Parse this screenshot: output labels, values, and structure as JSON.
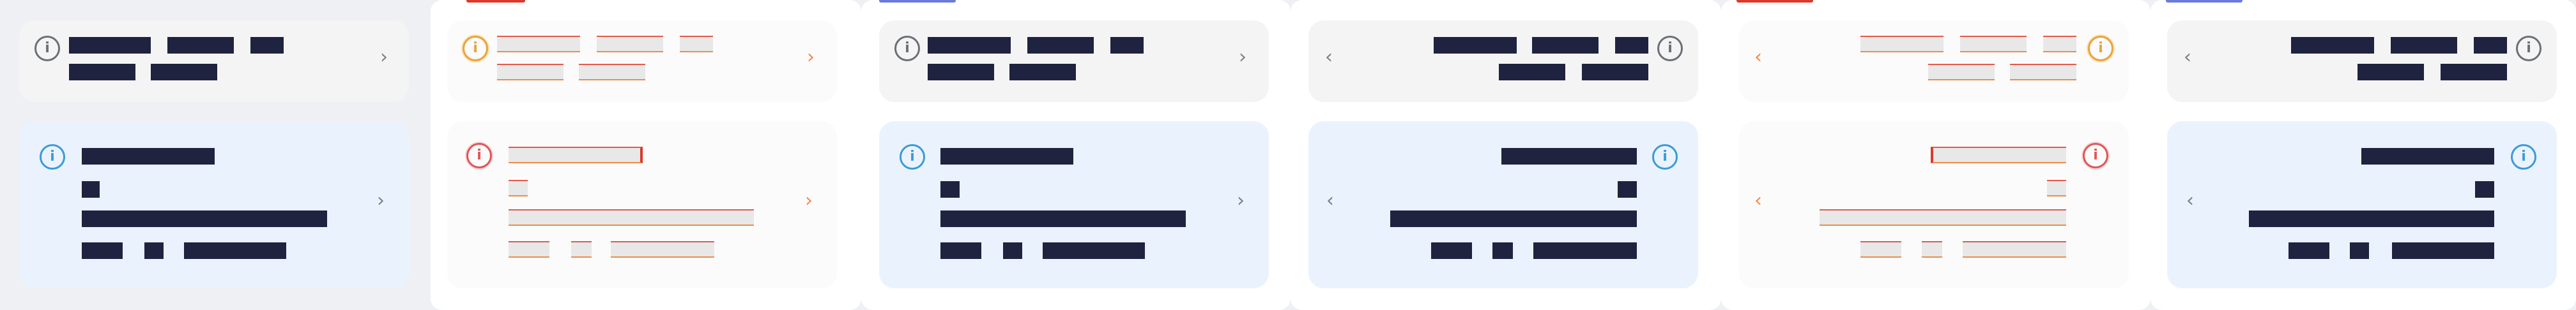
{
  "screen": {
    "title": "",
    "note": ""
  },
  "icons": {
    "info": "info-icon",
    "chevron_right": "chevron-right-icon",
    "chevron_left": "chevron-left-icon"
  },
  "colors": {
    "text_redaction": "#1f2340",
    "info_gray": "#6b6f76",
    "info_blue": "#3b9ad9",
    "card_gray": "#f4f4f5",
    "card_blue": "#eaf3fd",
    "accent_red": "#d93a2b",
    "accent_orange": "#f08a4b"
  },
  "glyphs": {
    "info": "i",
    "chevron_right": "›",
    "chevron_left": "‹"
  },
  "panels": [
    {
      "layout": "ltr",
      "variant": "normal",
      "accent": ""
    },
    {
      "layout": "ltr",
      "variant": "ghost",
      "accent": "red"
    },
    {
      "layout": "ltr",
      "variant": "normal",
      "accent": "blue"
    },
    {
      "layout": "rtl",
      "variant": "normal",
      "accent": ""
    },
    {
      "layout": "rtl",
      "variant": "ghost",
      "accent": "red"
    },
    {
      "layout": "rtl",
      "variant": "normal",
      "accent": "blue"
    }
  ]
}
